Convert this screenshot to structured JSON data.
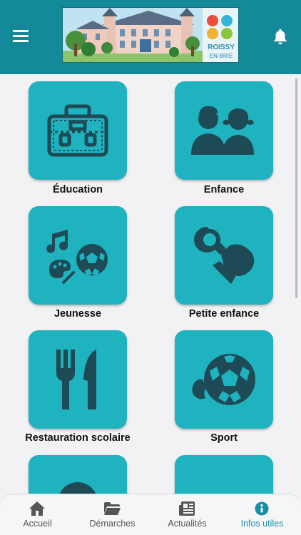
{
  "header": {
    "menu_icon": "hamburger-menu-icon",
    "notification_icon": "bell-icon",
    "banner_logo_text_1": "ROISSY",
    "banner_logo_text_2": "EN-BRIE"
  },
  "tiles": [
    {
      "label": "Éducation",
      "icon": "briefcase-icon"
    },
    {
      "label": "Enfance",
      "icon": "children-icon"
    },
    {
      "label": "Jeunesse",
      "icon": "music-ball-palette-icon"
    },
    {
      "label": "Petite enfance",
      "icon": "pacifier-icon"
    },
    {
      "label": "Restauration scolaire",
      "icon": "fork-knife-icon"
    },
    {
      "label": "Sport",
      "icon": "soccer-ball-icon"
    }
  ],
  "tabbar": {
    "items": [
      {
        "label": "Accueil",
        "icon": "home-icon",
        "active": false
      },
      {
        "label": "Démarches",
        "icon": "folder-icon",
        "active": false
      },
      {
        "label": "Actualités",
        "icon": "newspaper-icon",
        "active": false
      },
      {
        "label": "Infos utiles",
        "icon": "info-icon",
        "active": true
      }
    ]
  },
  "colors": {
    "header": "#14899a",
    "tile": "#1fb2bf",
    "icon": "#1d4a55",
    "active_tab": "#1a8ea4"
  }
}
